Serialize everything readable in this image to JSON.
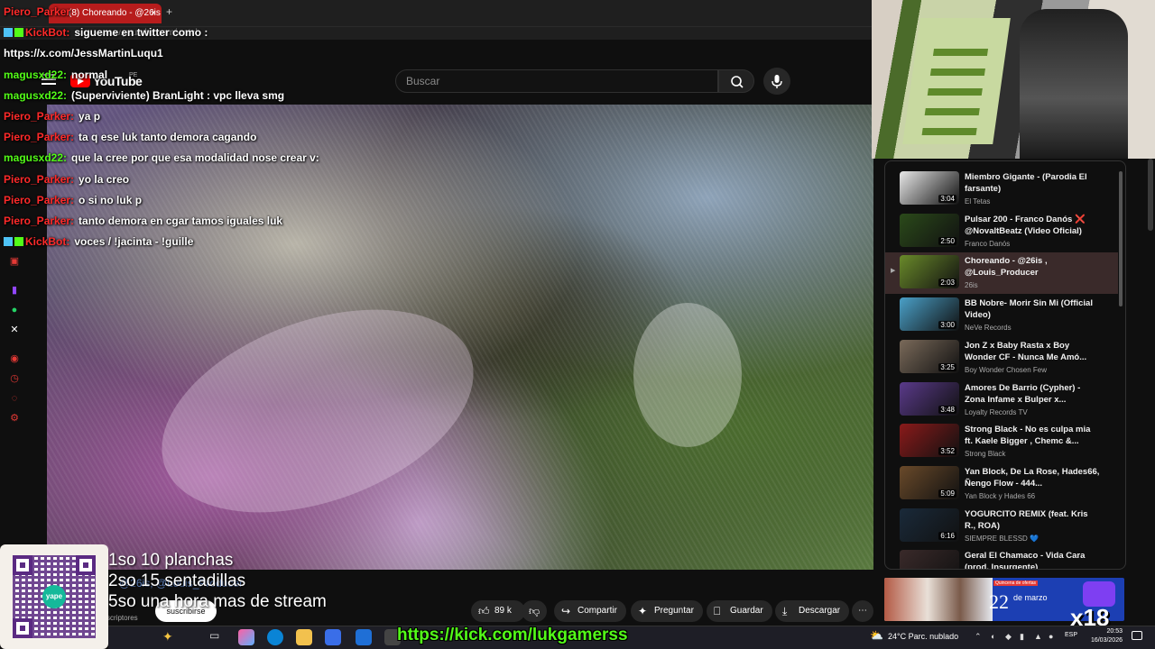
{
  "browser": {
    "tab_title": "(8) Choreando - @26is",
    "tab_close": "×",
    "new_tab": "+",
    "url": "www.youtube.com/watch"
  },
  "youtube": {
    "logo_text": "YouTube",
    "country": "PE",
    "search_placeholder": "Buscar",
    "subscribe_label": "suscribirse",
    "subscribers_label": "scriptores",
    "channel_ghost": "@26is, @Louis_Producer",
    "actions": {
      "likes": "89 k",
      "share": "Compartir",
      "ask": "Preguntar",
      "save": "Guardar",
      "download": "Descargar"
    }
  },
  "chat": [
    {
      "user": "Piero_Parker",
      "color": "red",
      "message": "",
      "badges": 0
    },
    {
      "user": "KickBot:",
      "color": "red",
      "message": "sigueme en twitter como :",
      "badges": 2
    },
    {
      "user": "",
      "color": "green",
      "message": "https://x.com/JessMartinLuqu1",
      "badges": 0
    },
    {
      "user": "magusxd22:",
      "color": "green",
      "message": "normal",
      "badges": 0
    },
    {
      "user": "magusxd22:",
      "color": "green",
      "message": "(Superviviente) BranLight : vpc lleva smg",
      "badges": 0
    },
    {
      "user": "Piero_Parker:",
      "color": "red",
      "message": "ya p",
      "badges": 0
    },
    {
      "user": "Piero_Parker:",
      "color": "red",
      "message": "ta q ese luk tanto demora cagando",
      "badges": 0
    },
    {
      "user": "magusxd22:",
      "color": "green",
      "message": "que la cree por que esa modalidad nose crear v:",
      "badges": 0
    },
    {
      "user": "Piero_Parker:",
      "color": "red",
      "message": "yo la creo",
      "badges": 0
    },
    {
      "user": "Piero_Parker:",
      "color": "red",
      "message": "o si no luk p",
      "badges": 0
    },
    {
      "user": "Piero_Parker:",
      "color": "red",
      "message": "tanto demora en cgar tamos iguales luk",
      "badges": 0
    },
    {
      "user": "KickBot:",
      "color": "red",
      "message": "voces / !jacinta - !guille",
      "badges": 2
    }
  ],
  "playlist": [
    {
      "title": "Miembro Gigante - (Parodia El farsante)",
      "channel": "El Tetas",
      "duration": "3:04",
      "thumb": "#e8e8e8",
      "active": false
    },
    {
      "title": "Pulsar 200 - Franco Danós ❌ @NovaltBeatz (Video Oficial)",
      "channel": "Franco Danós",
      "duration": "2:50",
      "thumb": "#2b4a1a",
      "active": false
    },
    {
      "title": "Choreando - @26is , @Louis_Producer",
      "channel": "26is",
      "duration": "2:03",
      "thumb": "#6a8a2a",
      "active": true,
      "marker": "▶"
    },
    {
      "title": "BB Nobre- Morir Sin Mi (Official Video)",
      "channel": "NeVe Records",
      "duration": "3:00",
      "thumb": "#4aa0c8",
      "active": false
    },
    {
      "title": "Jon Z x Baby Rasta x Boy Wonder CF - Nunca Me Amó...",
      "channel": "Boy Wonder Chosen Few",
      "duration": "3:25",
      "thumb": "#7a6a5a",
      "active": false
    },
    {
      "title": "Amores De Barrio (Cypher) - Zona Infame x Bulper x...",
      "channel": "Loyalty Records TV",
      "duration": "3:48",
      "thumb": "#5a3a8a",
      "active": false
    },
    {
      "title": "Strong Black - No es culpa mia ft. Kaele Bigger , Chemc &...",
      "channel": "Strong Black",
      "duration": "3:52",
      "thumb": "#8a1a1a",
      "active": false
    },
    {
      "title": "Yan Block, De La Rose, Hades66, Ñengo Flow - 444...",
      "channel": "Yan Block y Hades 66",
      "duration": "5:09",
      "thumb": "#6a4a2a",
      "active": false
    },
    {
      "title": "YOGURCITO REMIX (feat. Kris R., ROA)",
      "channel": "SIEMPRE BLESSD 💙",
      "duration": "6:16",
      "thumb": "#1a2a3a",
      "active": false
    },
    {
      "title": "Geral El Chamaco - Vida Cara (prod. Insurgente)",
      "channel": "",
      "duration": "",
      "thumb": "#3a2a2a",
      "active": false
    }
  ],
  "ad": {
    "top_label": "Quincena de ofertas",
    "day": "22",
    "month": "de marzo"
  },
  "overlay": {
    "goals": [
      "1so 10 planchas",
      "2so 15 sentadillas",
      "5so una hora mas de stream"
    ],
    "kick_url": "https://kick.com/lukgamerss",
    "qr_label": "yape",
    "x18": "x18"
  },
  "taskbar": {
    "weather": "24°C  Parc. nublado",
    "lang": "ESP",
    "time": "20:53",
    "date": "16/03/2026"
  }
}
